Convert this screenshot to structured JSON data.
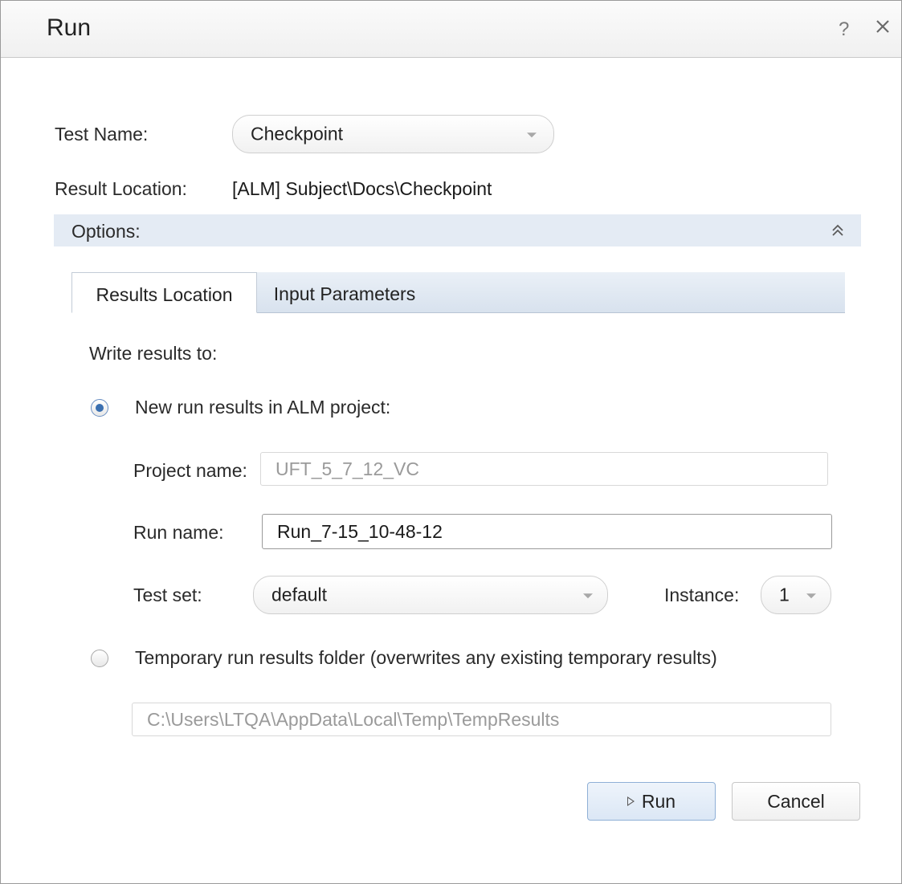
{
  "window": {
    "title": "Run",
    "help_glyph": "?",
    "close_icon": "close-icon"
  },
  "test_name": {
    "label": "Test Name:",
    "value": "Checkpoint"
  },
  "result_location": {
    "label": "Result Location:",
    "value": "[ALM] Subject\\Docs\\Checkpoint"
  },
  "options": {
    "label": "Options:",
    "collapse_icon": "double-chevron-up-icon"
  },
  "tabs": [
    {
      "label": "Results Location",
      "active": true
    },
    {
      "label": "Input Parameters",
      "active": false
    }
  ],
  "results": {
    "write_to_label": "Write results to:",
    "alm_option": {
      "label": "New run results in ALM project:",
      "selected": true
    },
    "project_name": {
      "label": "Project name:",
      "value": "UFT_5_7_12_VC"
    },
    "run_name": {
      "label": "Run name:",
      "value": "Run_7-15_10-48-12"
    },
    "test_set": {
      "label": "Test set:",
      "value": "default"
    },
    "instance": {
      "label": "Instance:",
      "value": "1"
    },
    "temp_option": {
      "label": "Temporary run results folder (overwrites any existing temporary results)",
      "selected": false
    },
    "temp_path": {
      "value": "C:\\Users\\LTQA\\AppData\\Local\\Temp\\TempResults"
    }
  },
  "buttons": {
    "run_label": "Run",
    "cancel_label": "Cancel"
  },
  "colors": {
    "options_bar": "#e4ebf4",
    "radio_selected": "#3a6fb0",
    "primary_button_border": "#8fb0d6"
  }
}
